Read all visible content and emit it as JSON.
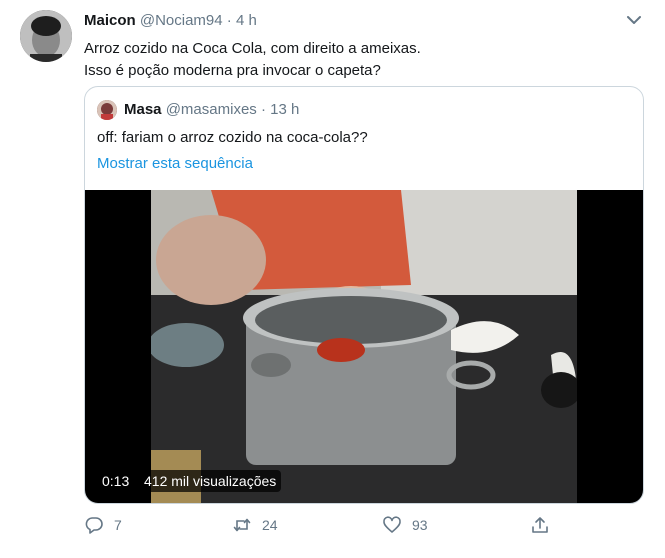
{
  "tweet": {
    "author_name": "Maicon",
    "author_handle": "@Nociam94",
    "separator": "·",
    "time": "4 h",
    "text_line1": "Arroz cozido na Coca Cola, com direito a ameixas.",
    "text_line2": "Isso é poção moderna pra invocar o capeta?"
  },
  "quote": {
    "author_name": "Masa",
    "author_handle": "@masamixes",
    "separator": "·",
    "time": "13 h",
    "text": "off: fariam o arroz cozido na coca-cola??",
    "thread_link": "Mostrar esta sequência",
    "video": {
      "time": "0:13",
      "views": "412 mil visualizações"
    }
  },
  "actions": {
    "reply_count": "7",
    "retweet_count": "24",
    "like_count": "93"
  },
  "icons": {
    "menu": "chevron-down-icon",
    "reply": "reply-icon",
    "retweet": "retweet-icon",
    "like": "heart-icon",
    "share": "share-icon"
  },
  "colors": {
    "link": "#1b95e0",
    "muted": "#657786",
    "border": "#ccd6dd"
  }
}
